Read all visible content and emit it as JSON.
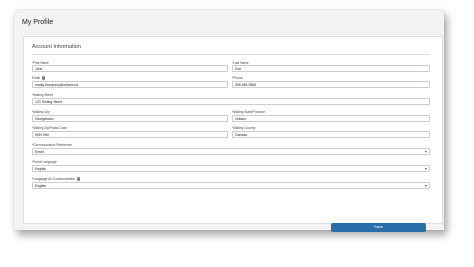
{
  "page": {
    "title": "My Profile"
  },
  "section": {
    "title": "Account Information"
  },
  "fields": {
    "first_name": {
      "label": "First Name",
      "value": "John"
    },
    "last_name": {
      "label": "Last Name",
      "value": "Doe"
    },
    "email": {
      "label": "Email",
      "value": "marky.thompson@ontario.ca"
    },
    "phone": {
      "label": "Phone",
      "value": "555-555-5555"
    },
    "mailing_street": {
      "label": "Mailing Street",
      "value": "123 Testing Street"
    },
    "mailing_city": {
      "label": "Mailing City",
      "value": "Georgetown"
    },
    "mailing_state": {
      "label": "Mailing State/Province",
      "value": "Ontario"
    },
    "mailing_zip": {
      "label": "Mailing Zip/Postal Code",
      "value": "N0N 0N0"
    },
    "mailing_country": {
      "label": "Mailing Country",
      "value": "Canada"
    },
    "communication_preference": {
      "label": "Communication Preference",
      "value": "Email"
    },
    "portal_language": {
      "label": "Portal Language",
      "value": "English"
    },
    "language_for_communication": {
      "label": "Language for Communication",
      "value": "English"
    }
  },
  "required_marker": "*",
  "buttons": {
    "save": "Save"
  },
  "colors": {
    "accent": "#2a6dab",
    "background": "#f3f3f3"
  },
  "icons": {
    "info": "info-icon",
    "dropdown": "chevron-down-icon"
  }
}
